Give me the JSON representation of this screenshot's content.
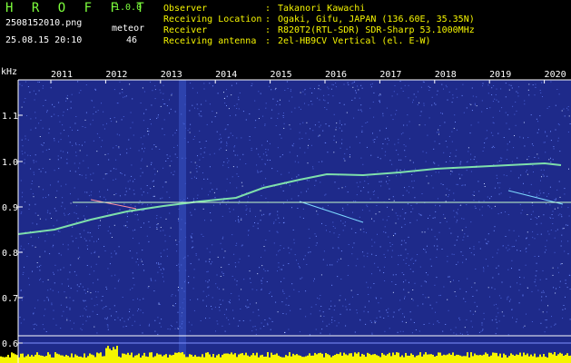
{
  "header": {
    "app_title": "H R O F F T",
    "version": "1.0.0",
    "file_name": "2508152010.png",
    "meteor_label": "meteor",
    "date_time": "25.08.15 20:10",
    "meteor_count": "46",
    "info": [
      {
        "key": "Observer",
        "value": "Takanori Kawachi"
      },
      {
        "key": "Receiving Location",
        "value": "Ogaki, Gifu, JAPAN (136.60E, 35.35N)"
      },
      {
        "key": "Receiver",
        "value": "R820T2(RTL-SDR) SDR-Sharp 53.1000MHz"
      },
      {
        "key": "Receiving antenna",
        "value": "2el-HB9CV Vertical (el. E-W)"
      }
    ]
  },
  "spectrogram": {
    "y_unit": "kHz",
    "y_ticks": [
      "1.1",
      "1.0",
      "0.9",
      "0.8",
      "0.7",
      "0.6"
    ],
    "year_labels": [
      "2011",
      "2012",
      "2013",
      "2014",
      "2015",
      "2016",
      "2017",
      "2018",
      "2019",
      "2020"
    ],
    "colors": {
      "background": "#1e2a8a",
      "noise": "#6f8cff",
      "signal": "#c8ffc8",
      "axis": "#ffffff",
      "yellow": "#f5f500"
    }
  }
}
